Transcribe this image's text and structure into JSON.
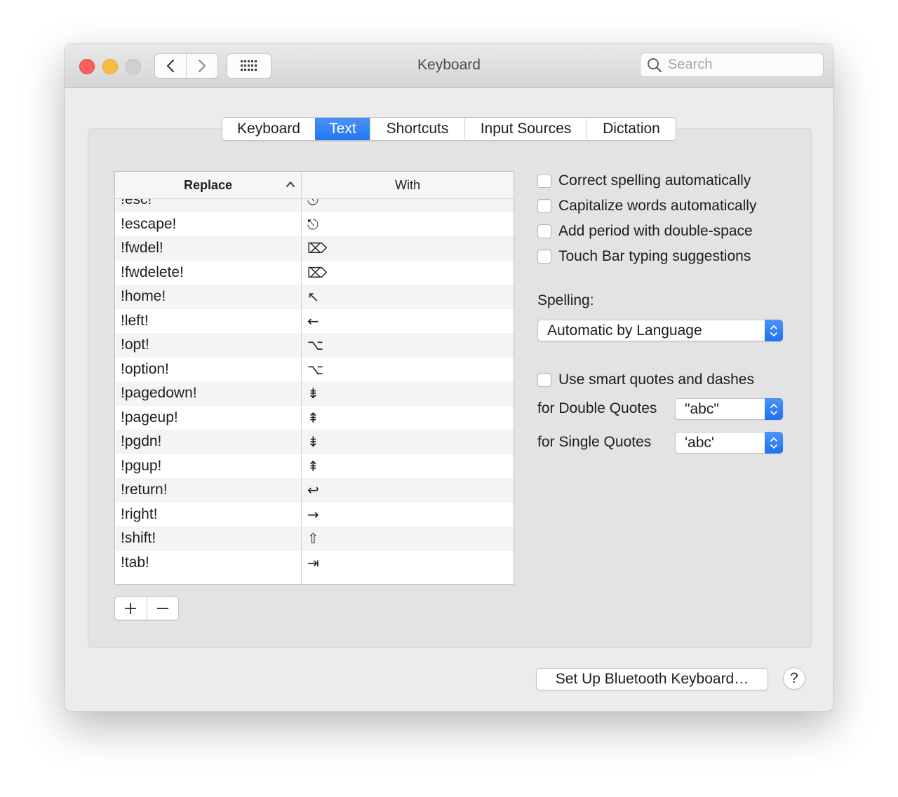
{
  "window": {
    "title": "Keyboard"
  },
  "search": {
    "placeholder": "Search"
  },
  "tabs": [
    {
      "label": "Keyboard",
      "active": false
    },
    {
      "label": "Text",
      "active": true
    },
    {
      "label": "Shortcuts",
      "active": false
    },
    {
      "label": "Input Sources",
      "active": false
    },
    {
      "label": "Dictation",
      "active": false
    }
  ],
  "table": {
    "columns": {
      "replace": "Replace",
      "with": "With"
    },
    "rows": [
      {
        "replace": "!esc!",
        "with": "⎋"
      },
      {
        "replace": "!escape!",
        "with": "⎋"
      },
      {
        "replace": "!fwdel!",
        "with": "⌦"
      },
      {
        "replace": "!fwdelete!",
        "with": "⌦"
      },
      {
        "replace": "!home!",
        "with": "↖"
      },
      {
        "replace": "!left!",
        "with": "←"
      },
      {
        "replace": "!opt!",
        "with": "⌥"
      },
      {
        "replace": "!option!",
        "with": "⌥"
      },
      {
        "replace": "!pagedown!",
        "with": "⇟"
      },
      {
        "replace": "!pageup!",
        "with": "⇞"
      },
      {
        "replace": "!pgdn!",
        "with": "⇟"
      },
      {
        "replace": "!pgup!",
        "with": "⇞"
      },
      {
        "replace": "!return!",
        "with": "↩"
      },
      {
        "replace": "!right!",
        "with": "→"
      },
      {
        "replace": "!shift!",
        "with": "⇧"
      },
      {
        "replace": "!tab!",
        "with": "⇥"
      }
    ]
  },
  "options": {
    "correct_spelling": "Correct spelling automatically",
    "capitalize_words": "Capitalize words automatically",
    "add_period": "Add period with double-space",
    "touch_bar": "Touch Bar typing suggestions"
  },
  "spelling": {
    "label": "Spelling:",
    "value": "Automatic by Language"
  },
  "quotes": {
    "smart_label": "Use smart quotes and dashes",
    "double_label": "for Double Quotes",
    "double_value": "\"abc\"",
    "single_label": "for Single Quotes",
    "single_value": "'abc'"
  },
  "buttons": {
    "bluetooth": "Set Up Bluetooth Keyboard…",
    "help": "?"
  },
  "colors": {
    "accent": "#2f7cf6"
  }
}
